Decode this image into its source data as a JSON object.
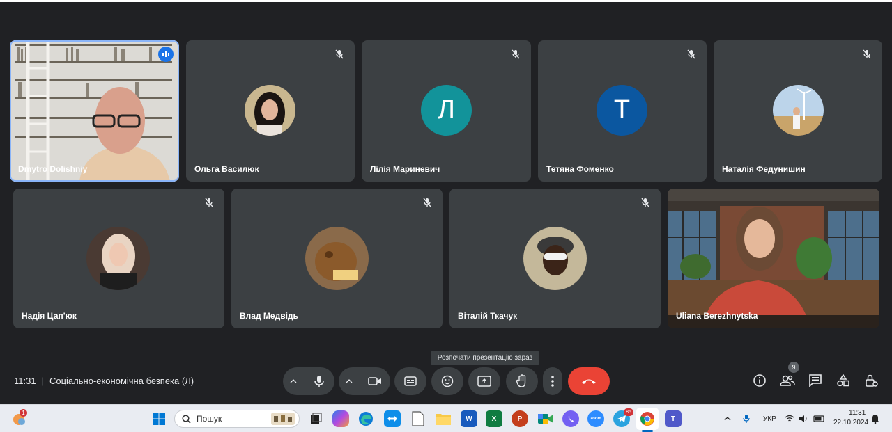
{
  "participants": [
    {
      "name": "Dmytro Dolishniy",
      "type": "video",
      "speaking": true
    },
    {
      "name": "Ольга Василюк",
      "type": "photo",
      "muted": true
    },
    {
      "name": "Лілія Мариневич",
      "type": "initial",
      "initial": "Л",
      "color": "#12939a",
      "muted": true
    },
    {
      "name": "Тетяна Фоменко",
      "type": "initial",
      "initial": "Т",
      "color": "#0b57a0",
      "muted": true
    },
    {
      "name": "Наталія Федунишин",
      "type": "photo",
      "muted": true
    },
    {
      "name": "Надія Цап'юк",
      "type": "photo",
      "muted": true
    },
    {
      "name": "Влад Медвідь",
      "type": "photo",
      "muted": true
    },
    {
      "name": "Віталій Ткачук",
      "type": "photo",
      "muted": true
    },
    {
      "name": "Uliana Berezhnytska",
      "type": "video"
    }
  ],
  "tooltip": "Розпочати презентацію зараз",
  "meeting": {
    "time": "11:31",
    "title": "Соціально-економічна безпека (Л)"
  },
  "controls": {
    "left": [
      "caret-up-icon",
      "microphone-icon",
      "caret-up-icon",
      "camera-icon",
      "captions-icon",
      "emoji-icon",
      "present-screen-icon",
      "raise-hand-icon",
      "more-options-icon",
      "hang-up-icon"
    ],
    "right": [
      "info-icon",
      "people-icon",
      "chat-icon",
      "activities-icon",
      "host-controls-icon"
    ],
    "people_count": "9"
  },
  "taskbar": {
    "search_placeholder": "Пошук",
    "notification_count": "1",
    "telegram_badge": "85",
    "language": "УКР",
    "clock_time": "11:31",
    "clock_date": "22.10.2024",
    "apps": [
      "windows-start",
      "task-view",
      "copilot",
      "edge",
      "teamviewer",
      "notepad",
      "file-explorer",
      "word",
      "excel",
      "powerpoint",
      "google-meet",
      "viber",
      "zoom",
      "telegram",
      "chrome",
      "teams"
    ]
  },
  "colors": {
    "background": "#202124",
    "tile": "#3c4043",
    "hangup": "#ea4335",
    "accent": "#8ab4f8"
  }
}
